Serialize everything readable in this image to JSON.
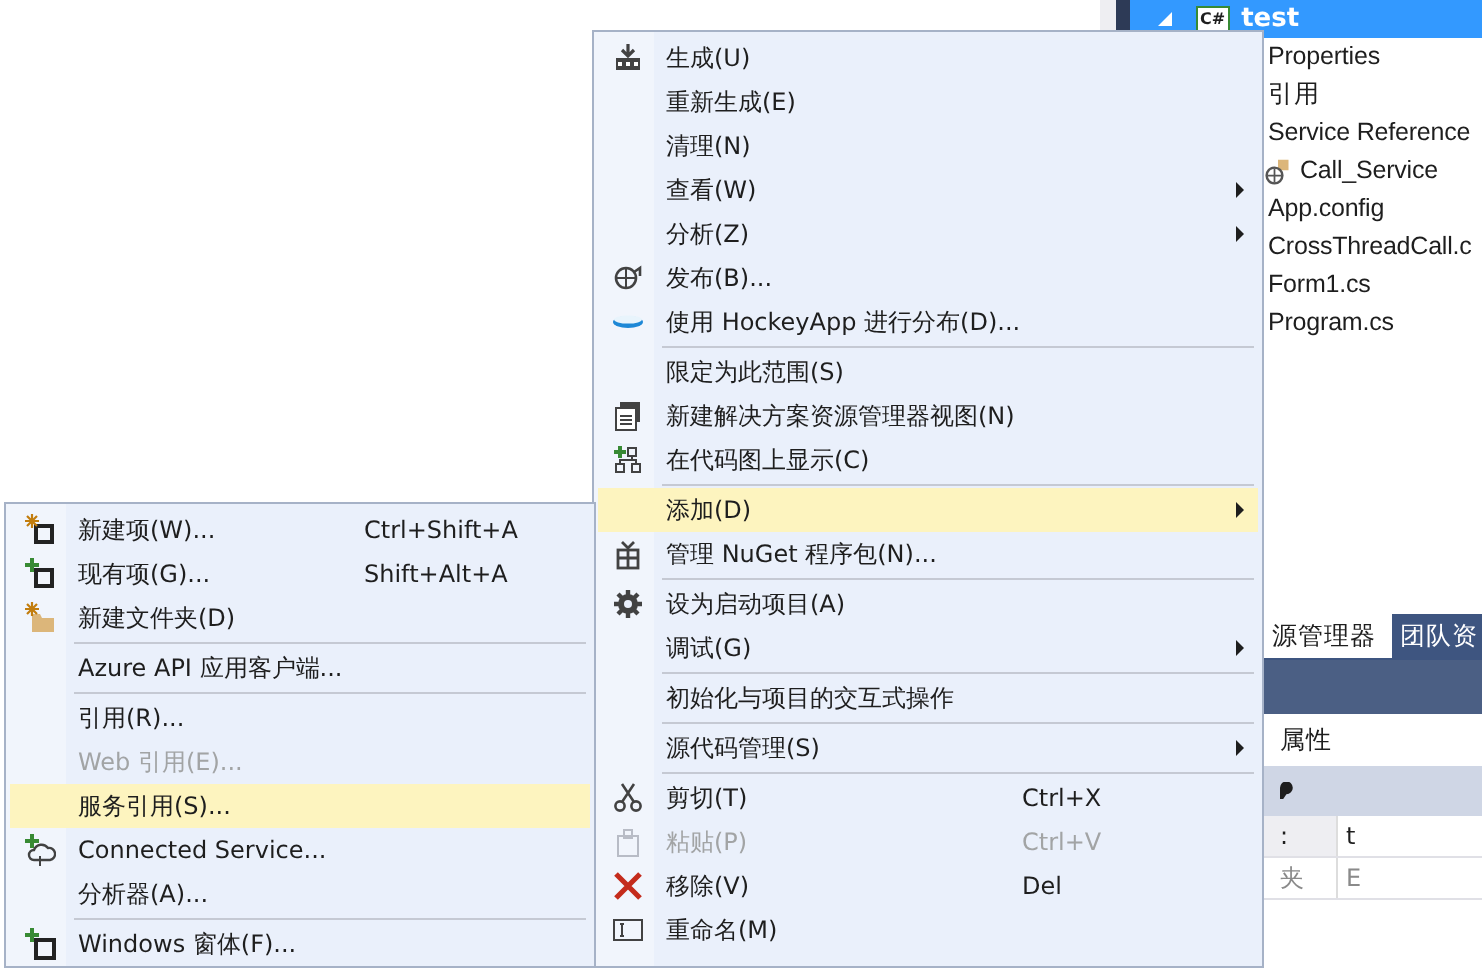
{
  "solution_tree": {
    "label": "test",
    "badge": "C#",
    "selected": true,
    "expanded": true,
    "children": [
      {
        "label": "Properties"
      },
      {
        "label": "引用"
      },
      {
        "label": "Service Reference",
        "children": [
          {
            "label": "Call_Service"
          }
        ]
      },
      {
        "label": "App.config"
      },
      {
        "label": "CrossThreadCall.c"
      },
      {
        "label": "Form1.cs"
      },
      {
        "label": "Program.cs"
      }
    ]
  },
  "bottom_tabs": [
    {
      "label": "源管理器",
      "selected": false
    },
    {
      "label": "团队资",
      "selected": true
    }
  ],
  "properties": {
    "title": "属性",
    "rows": [
      {
        "column_1": ":",
        "column_2": "t"
      },
      {
        "column_1": "夹",
        "column_2": "E"
      }
    ]
  },
  "context_menu": {
    "items": [
      {
        "kind": "item",
        "label": "生成(U)",
        "submenu": false,
        "disabled": false,
        "selected": false
      },
      {
        "kind": "item",
        "label": "重新生成(E)",
        "submenu": false,
        "disabled": false,
        "selected": false
      },
      {
        "kind": "item",
        "label": "清理(N)",
        "submenu": false,
        "disabled": false,
        "selected": false
      },
      {
        "kind": "item",
        "label": "查看(W)",
        "submenu": true,
        "disabled": false,
        "selected": false
      },
      {
        "kind": "item",
        "label": "分析(Z)",
        "submenu": true,
        "disabled": false,
        "selected": false
      },
      {
        "kind": "item",
        "label": "发布(B)...",
        "submenu": false,
        "disabled": false,
        "selected": false
      },
      {
        "kind": "item",
        "label": "使用 HockeyApp 进行分布(D)...",
        "submenu": false,
        "disabled": false,
        "selected": false
      },
      {
        "kind": "separator"
      },
      {
        "kind": "item",
        "label": "限定为此范围(S)",
        "submenu": false,
        "disabled": false,
        "selected": false
      },
      {
        "kind": "item",
        "label": "新建解决方案资源管理器视图(N)",
        "submenu": false,
        "disabled": false,
        "selected": false
      },
      {
        "kind": "item",
        "label": "在代码图上显示(C)",
        "submenu": false,
        "disabled": false,
        "selected": false
      },
      {
        "kind": "separator"
      },
      {
        "kind": "item",
        "label": "添加(D)",
        "submenu": true,
        "disabled": false,
        "selected": true
      },
      {
        "kind": "item",
        "label": "管理 NuGet 程序包(N)...",
        "submenu": false,
        "disabled": false,
        "selected": false
      },
      {
        "kind": "separator"
      },
      {
        "kind": "item",
        "label": "设为启动项目(A)",
        "submenu": false,
        "disabled": false,
        "selected": false
      },
      {
        "kind": "item",
        "label": "调试(G)",
        "submenu": true,
        "disabled": false,
        "selected": false
      },
      {
        "kind": "separator"
      },
      {
        "kind": "item",
        "label": "初始化与项目的交互式操作",
        "submenu": false,
        "disabled": false,
        "selected": false
      },
      {
        "kind": "separator"
      },
      {
        "kind": "item",
        "label": "源代码管理(S)",
        "submenu": true,
        "disabled": false,
        "selected": false
      },
      {
        "kind": "separator"
      },
      {
        "kind": "item",
        "label": "剪切(T)",
        "shortcut": "Ctrl+X",
        "submenu": false,
        "disabled": false,
        "selected": false
      },
      {
        "kind": "item",
        "label": "粘贴(P)",
        "shortcut": "Ctrl+V",
        "submenu": false,
        "disabled": true,
        "selected": false
      },
      {
        "kind": "item",
        "label": "移除(V)",
        "shortcut": "Del",
        "submenu": false,
        "disabled": false,
        "selected": false
      },
      {
        "kind": "item",
        "label": "重命名(M)",
        "submenu": false,
        "disabled": false,
        "selected": false
      }
    ]
  },
  "add_submenu": {
    "items": [
      {
        "kind": "item",
        "label": "新建项(W)...",
        "shortcut": "Ctrl+Shift+A",
        "disabled": false,
        "selected": false
      },
      {
        "kind": "item",
        "label": "现有项(G)...",
        "shortcut": "Shift+Alt+A",
        "disabled": false,
        "selected": false
      },
      {
        "kind": "item",
        "label": "新建文件夹(D)",
        "disabled": false,
        "selected": false
      },
      {
        "kind": "separator"
      },
      {
        "kind": "item",
        "label": "Azure API 应用客户端...",
        "disabled": false,
        "selected": false
      },
      {
        "kind": "separator"
      },
      {
        "kind": "item",
        "label": "引用(R)...",
        "disabled": false,
        "selected": false
      },
      {
        "kind": "item",
        "label": "Web 引用(E)...",
        "disabled": true,
        "selected": false
      },
      {
        "kind": "item",
        "label": "服务引用(S)...",
        "disabled": false,
        "selected": true
      },
      {
        "kind": "item",
        "label": "Connected Service...",
        "disabled": false,
        "selected": false
      },
      {
        "kind": "item",
        "label": "分析器(A)...",
        "disabled": false,
        "selected": false
      },
      {
        "kind": "separator"
      },
      {
        "kind": "item",
        "label": "Windows 窗体(F)...",
        "disabled": false,
        "selected": false
      }
    ]
  }
}
